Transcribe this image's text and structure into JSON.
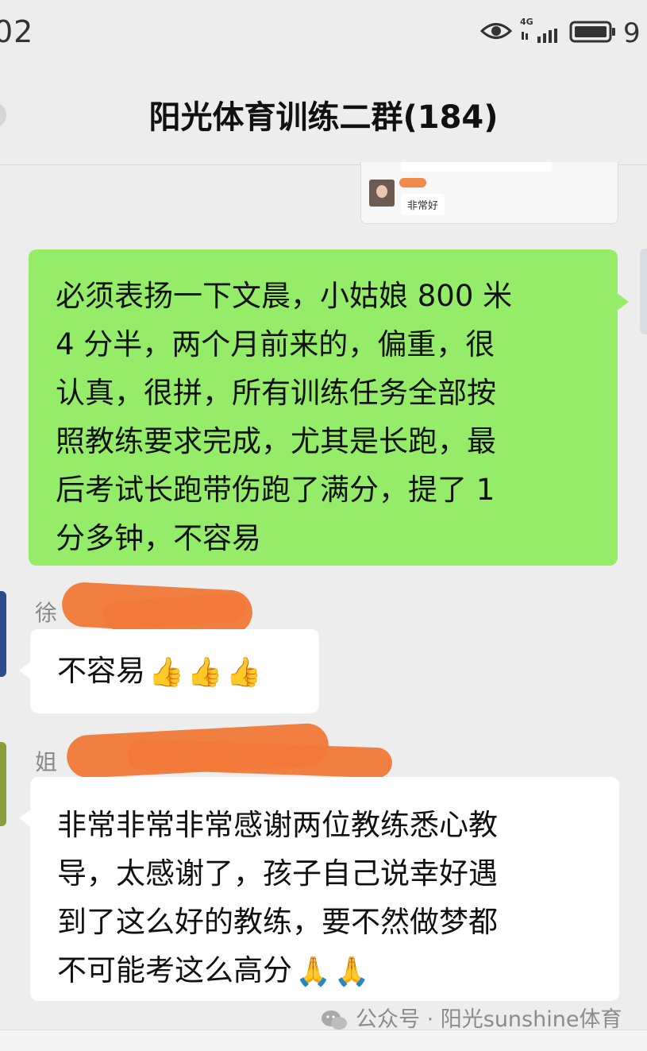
{
  "status_bar": {
    "time": "02",
    "network": "4G",
    "battery_pct": "9"
  },
  "chat": {
    "title": "阳光体育训练二群(184)"
  },
  "previous_card": {
    "reply": "非常好"
  },
  "messages": [
    {
      "side": "self",
      "text": "必须表扬一下文晨，小姑娘 800 米\n4 分半，两个月前来的，偏重，很\n认真，很拼，所有训练任务全部按\n照教练要求完成，尤其是长跑，最\n后考试长跑带伤跑了满分，提了 1\n分多钟，不容易"
    },
    {
      "side": "other",
      "sender_visible": "徐",
      "text": "不容易",
      "emoji_icon": "thumbs-up",
      "emoji": [
        "👍",
        "👍",
        "👍"
      ]
    },
    {
      "side": "other",
      "sender_visible": "姐",
      "text": "非常非常非常感谢两位教练悉心教\n导，太感谢了，孩子自己说幸好遇\n到了这么好的教练，要不然做梦都\n不可能考这么高分",
      "emoji_icon": "folded-hands",
      "emoji": [
        "🙏",
        "🙏"
      ]
    }
  ],
  "watermark": "公众号 · 阳光sunshine体育",
  "colors": {
    "self_bubble": "#95ec69",
    "other_bubble": "#ffffff",
    "background": "#ededed",
    "redaction": "#f07a3a"
  }
}
